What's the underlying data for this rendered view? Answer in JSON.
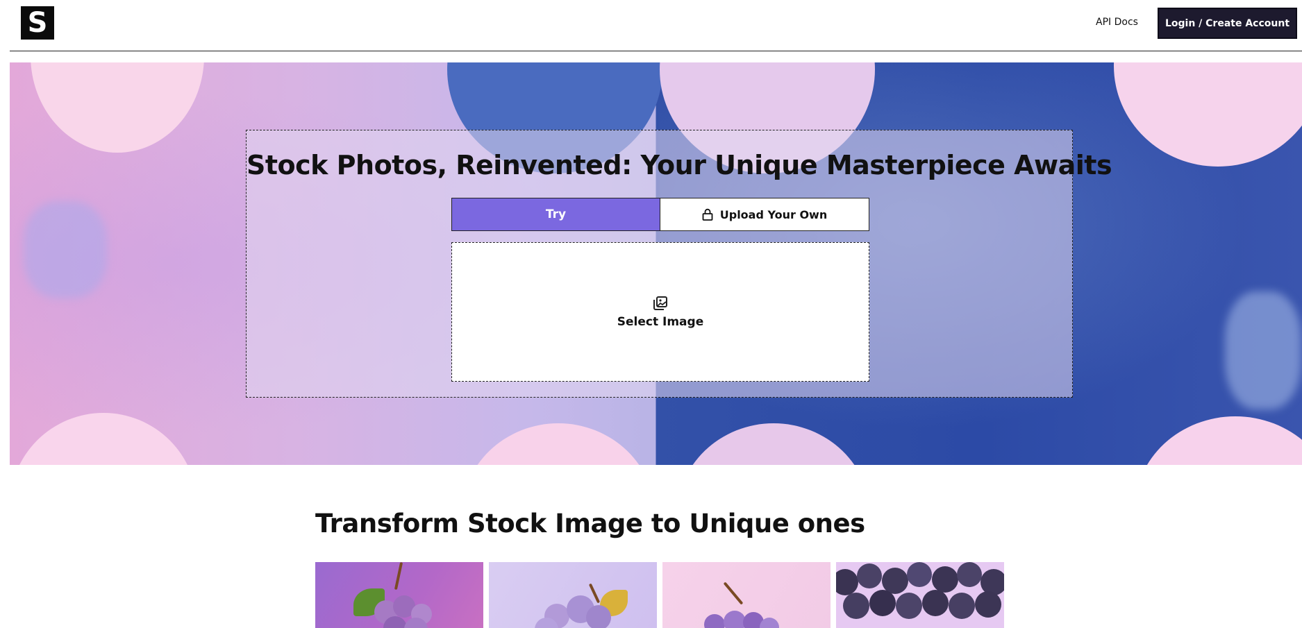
{
  "header": {
    "logo_letter": "S",
    "api_docs_label": "API Docs",
    "login_label": "Login / Create Account"
  },
  "hero": {
    "title": "Stock Photos, Reinvented: Your Unique Masterpiece Awaits",
    "tabs": [
      {
        "label": "Try",
        "active": true
      },
      {
        "label": "Upload Your Own",
        "icon": "lock-icon",
        "active": false
      }
    ],
    "dropzone": {
      "icon": "images-icon",
      "label": "Select Image"
    }
  },
  "section": {
    "title": "Transform Stock Image to Unique ones",
    "thumbnails": [
      {
        "subject": "purple grapes with leaf on magenta background"
      },
      {
        "subject": "lavender grapes with yellow leaf on lilac background"
      },
      {
        "subject": "purple grapes on pink background"
      },
      {
        "subject": "dark grape cluster close-up"
      }
    ]
  },
  "colors": {
    "accent": "#7b68e0",
    "login_button": "#1d1a2e",
    "text": "#111111"
  }
}
